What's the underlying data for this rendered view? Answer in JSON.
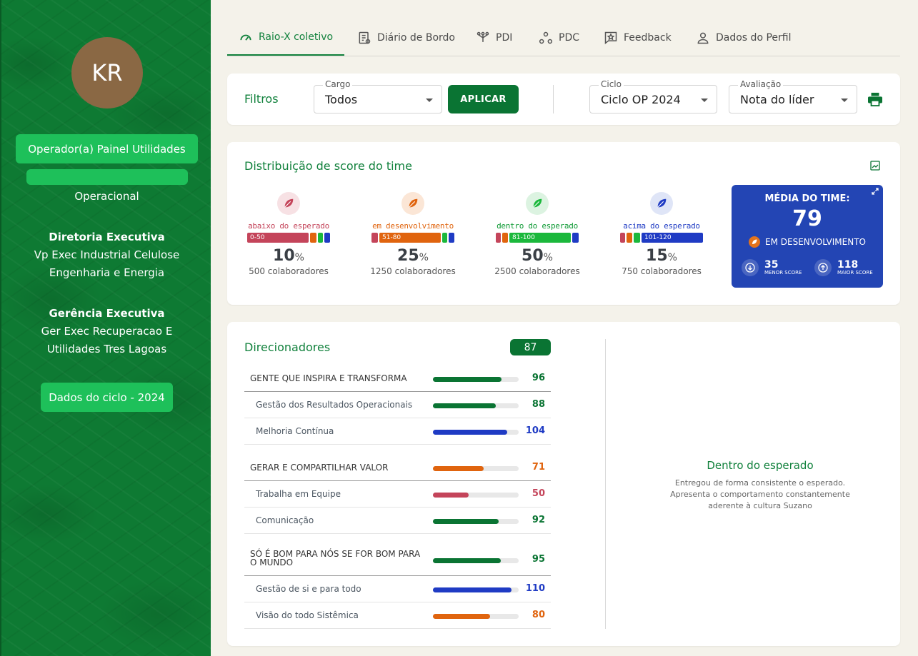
{
  "sidebar": {
    "avatar_initials": "KR",
    "role": "Operador(a) Painel Utilidades",
    "area": "Operacional",
    "directorate_title": "Diretoria Executiva",
    "directorate_line1": "Vp Exec Industrial Celulose",
    "directorate_line2": "Engenharia e Energia",
    "management_title": "Gerência Executiva",
    "management_line1": "Ger Exec Recuperacao E",
    "management_line2": "Utilidades Tres Lagoas",
    "cycle_button": "Dados do ciclo - 2024"
  },
  "tabs": [
    {
      "label": "Raio-X coletivo",
      "icon": "gauge-icon",
      "active": true
    },
    {
      "label": "Diário de Bordo",
      "icon": "notebook-icon"
    },
    {
      "label": "PDI",
      "icon": "tree-nodes-icon"
    },
    {
      "label": "PDC",
      "icon": "circles-icon"
    },
    {
      "label": "Feedback",
      "icon": "star-message-icon"
    },
    {
      "label": "Dados do Perfil",
      "icon": "person-icon"
    }
  ],
  "filters": {
    "label": "Filtros",
    "cargo": {
      "label": "Cargo",
      "value": "Todos"
    },
    "apply": "APLICAR",
    "ciclo": {
      "label": "Ciclo",
      "value": "Ciclo OP 2024"
    },
    "avaliacao": {
      "label": "Avaliação",
      "value": "Nota do líder"
    }
  },
  "distribution": {
    "title": "Distribuição de score do time",
    "categories": [
      {
        "name": "abaixo do esperado",
        "range": "0-50",
        "pct": "10",
        "count": "500 colaboradores",
        "color": "#c4445a"
      },
      {
        "name": "em desenvolvimento",
        "range": "51-80",
        "pct": "25",
        "count": "1250 colaboradores",
        "color": "#e0640e"
      },
      {
        "name": "dentro do esperado",
        "range": "81-100",
        "pct": "50",
        "count": "2500 colaboradores",
        "color": "#1bb83c"
      },
      {
        "name": "acima do esperado",
        "range": "101-120",
        "pct": "15",
        "count": "750 colaboradores",
        "color": "#1f3bc4"
      }
    ],
    "pct_symbol": "%",
    "average": {
      "title": "MÉDIA DO TIME:",
      "value": "79",
      "status": "EM DESENVOLVIMENTO",
      "min": "35",
      "min_label": "MENOR SCORE",
      "max": "118",
      "max_label": "MAIOR SCORE"
    }
  },
  "drivers": {
    "title": "Direcionadores",
    "score": "87",
    "rows": [
      {
        "name": "GENTE QUE INSPIRA E TRANSFORMA",
        "value": "96",
        "type": "group",
        "color": "#0a7433"
      },
      {
        "name": "Gestão dos Resultados Operacionais",
        "value": "88",
        "type": "sub",
        "color": "#0a7433"
      },
      {
        "name": "Melhoria Contínua",
        "value": "104",
        "type": "sub",
        "color": "#1f3bc4"
      },
      {
        "name": "GERAR E COMPARTILHAR VALOR",
        "value": "71",
        "type": "group",
        "color": "#e0640e"
      },
      {
        "name": "Trabalha em Equipe",
        "value": "50",
        "type": "sub",
        "color": "#c4445a"
      },
      {
        "name": "Comunicação",
        "value": "92",
        "type": "sub",
        "color": "#0a7433"
      },
      {
        "name": "SÓ É BOM PARA NÓS SE FOR BOM PARA O MUNDO",
        "value": "95",
        "type": "group",
        "color": "#0a7433"
      },
      {
        "name": "Gestão de si e para todo",
        "value": "110",
        "type": "sub",
        "color": "#1f3bc4"
      },
      {
        "name": "Visão do todo Sistêmica",
        "value": "80",
        "type": "sub",
        "color": "#e0640e"
      }
    ],
    "description_title": "Dentro do esperado",
    "description_text": "Entregou de forma consistente o esperado. Apresenta o comportamento constantemente aderente à cultura Suzano"
  }
}
